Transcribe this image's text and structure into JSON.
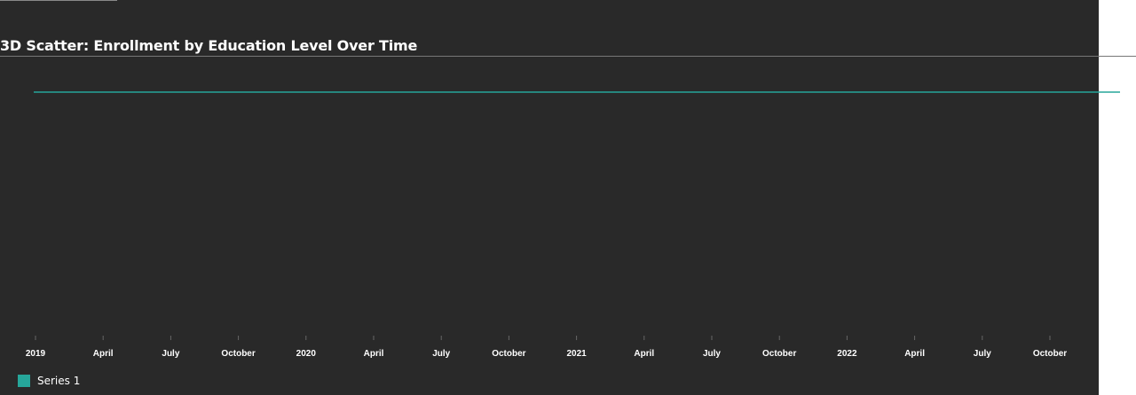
{
  "colors": {
    "background": "#292929",
    "series": "#26a69a",
    "text": "#ffffff",
    "tick": "#666666"
  },
  "chart_data": {
    "type": "line",
    "title": "3D Scatter: Enrollment by Education Level Over Time",
    "xlabel": "",
    "ylabel": "",
    "x_tick_labels": [
      "2019",
      "April",
      "July",
      "October",
      "2020",
      "April",
      "July",
      "October",
      "2021",
      "April",
      "July",
      "October",
      "2022",
      "April",
      "July",
      "October"
    ],
    "x_range": [
      "2019-01",
      "2022-12"
    ],
    "grid": false,
    "legend_position": "bottom-left",
    "series": [
      {
        "name": "Series 1",
        "color": "#26a69a",
        "x": [
          "2019-01",
          "2022-12"
        ],
        "values": [
          1,
          1
        ]
      }
    ]
  }
}
